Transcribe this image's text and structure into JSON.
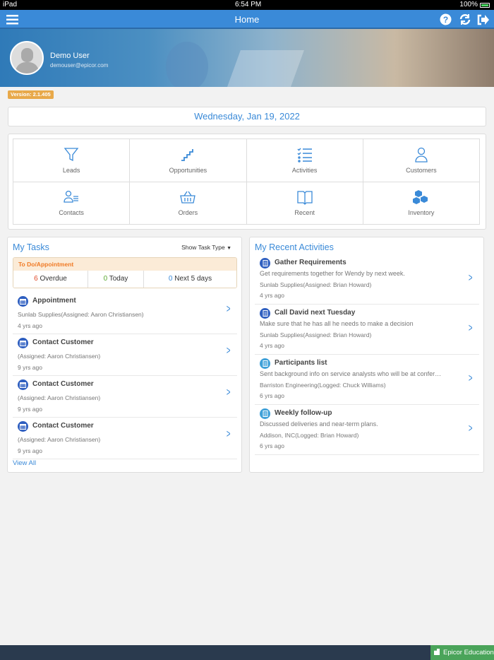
{
  "status_bar": {
    "device": "iPad",
    "time": "6:54 PM",
    "battery": "100%"
  },
  "header": {
    "title": "Home"
  },
  "user": {
    "name": "Demo User",
    "email": "demouser@epicor.com"
  },
  "version": "Version: 2.1.405",
  "date": "Wednesday, Jan 19, 2022",
  "tiles": [
    {
      "label": "Leads",
      "icon": "funnel-icon"
    },
    {
      "label": "Opportunities",
      "icon": "stairs-icon"
    },
    {
      "label": "Activities",
      "icon": "checklist-icon"
    },
    {
      "label": "Customers",
      "icon": "person-icon"
    },
    {
      "label": "Contacts",
      "icon": "contact-card-icon"
    },
    {
      "label": "Orders",
      "icon": "basket-icon"
    },
    {
      "label": "Recent",
      "icon": "book-icon"
    },
    {
      "label": "Inventory",
      "icon": "boxes-icon"
    }
  ],
  "tasks": {
    "title": "My Tasks",
    "filter": "Show Task Type",
    "section": "To Do/Appointment",
    "stats": [
      {
        "count": "6",
        "label": "Overdue",
        "color": "#e04a2a"
      },
      {
        "count": "0",
        "label": "Today",
        "color": "#5aa830"
      },
      {
        "count": "0",
        "label": "Next 5 days",
        "color": "#3a8ad8"
      }
    ],
    "items": [
      {
        "title": "Appointment",
        "detail": "Sunlab Supplies(Assigned: Aaron Christiansen)",
        "age": "4 yrs ago"
      },
      {
        "title": "Contact Customer",
        "detail": "(Assigned: Aaron Christiansen)",
        "age": "9 yrs ago"
      },
      {
        "title": "Contact Customer",
        "detail": "(Assigned: Aaron Christiansen)",
        "age": "9 yrs ago"
      },
      {
        "title": "Contact Customer",
        "detail": "(Assigned: Aaron Christiansen)",
        "age": "9 yrs ago"
      }
    ],
    "view_all": "View All"
  },
  "activities": {
    "title": "My Recent Activities",
    "items": [
      {
        "title": "Gather Requirements",
        "desc": "Get requirements together for Wendy by next week.",
        "detail": "Sunlab Supplies(Assigned: Brian Howard)",
        "age": "4 yrs ago",
        "color": "#2f5fc0"
      },
      {
        "title": "Call David next Tuesday",
        "desc": "Make sure that he has all he needs to make a decision",
        "detail": "Sunlab Supplies(Assigned: Brian Howard)",
        "age": "4 yrs ago",
        "color": "#2f5fc0"
      },
      {
        "title": "Participants list",
        "desc": "Sent background info on service analysts who will be at confer…",
        "detail": "Barriston Engineering(Logged: Chuck Williams)",
        "age": "6 yrs ago",
        "color": "#3fa0d8"
      },
      {
        "title": "Weekly follow-up",
        "desc": "Discussed deliveries and near-term plans.",
        "detail": "Addison, INC(Logged: Brian Howard)",
        "age": "6 yrs ago",
        "color": "#3fa0d8"
      }
    ]
  },
  "footer": {
    "badge": "Epicor Education"
  }
}
